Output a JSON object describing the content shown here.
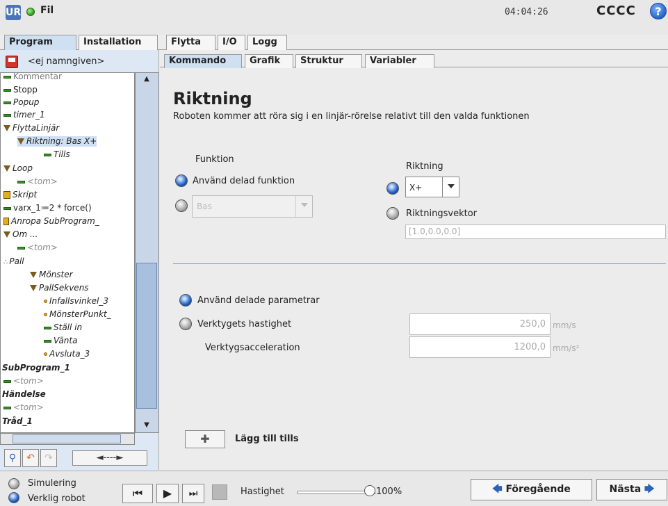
{
  "header": {
    "logo": "UR",
    "menu_label": "Fil",
    "clock": "04:04:26",
    "robot_name": "CCCC",
    "help_glyph": "?"
  },
  "main_tabs": [
    {
      "label": "Program",
      "active": true
    },
    {
      "label": "Installation",
      "active": false
    },
    {
      "label": "Flytta",
      "active": false
    },
    {
      "label": "I/O",
      "active": false
    },
    {
      "label": "Logg",
      "active": false
    }
  ],
  "program": {
    "name": "<ej namngiven>",
    "tree": [
      {
        "label": "Kommentar",
        "icon": "line-icon",
        "italic": false,
        "bold": false,
        "dim": true
      },
      {
        "label": "Stopp",
        "icon": "line-icon",
        "italic": false,
        "bold": false
      },
      {
        "label": "Popup",
        "icon": "line-icon",
        "italic": true,
        "bold": false
      },
      {
        "label": "timer_1",
        "icon": "line-icon",
        "italic": true,
        "bold": false
      },
      {
        "label": "FlyttaLinjär",
        "icon": "triangle-icon",
        "italic": true,
        "bold": false
      },
      {
        "label": "Riktning: Bas X+",
        "icon": "triangle-icon",
        "italic": true,
        "bold": false,
        "selected": true
      },
      {
        "label": "Tills",
        "icon": "line-icon",
        "italic": true,
        "bold": false
      },
      {
        "label": "Loop",
        "icon": "triangle-icon",
        "italic": true,
        "bold": false
      },
      {
        "label": "<tom>",
        "icon": "line-icon",
        "italic": true,
        "bold": false,
        "dim": true
      },
      {
        "label": "Skript",
        "icon": "script-icon",
        "italic": true,
        "bold": false
      },
      {
        "label": "varx_1≔2 * force()",
        "icon": "line-icon",
        "italic": false,
        "bold": false
      },
      {
        "label": "Anropa SubProgram_",
        "icon": "call-icon",
        "italic": true,
        "bold": false
      },
      {
        "label": "Om ...",
        "icon": "triangle-icon",
        "italic": true,
        "bold": false
      },
      {
        "label": "<tom>",
        "icon": "line-icon",
        "italic": true,
        "bold": false,
        "dim": true
      },
      {
        "label": "Pall",
        "icon": "pallet-icon",
        "italic": true,
        "bold": false
      },
      {
        "label": "Mönster",
        "icon": "triangle-icon",
        "italic": true,
        "bold": false
      },
      {
        "label": "PallSekvens",
        "icon": "triangle-icon",
        "italic": true,
        "bold": false
      },
      {
        "label": "Infallsvinkel_3",
        "icon": "waypoint-icon",
        "italic": true,
        "bold": false
      },
      {
        "label": "MönsterPunkt_",
        "icon": "waypoint-icon",
        "italic": true,
        "bold": false
      },
      {
        "label": "Ställ in",
        "icon": "line-icon",
        "italic": true,
        "bold": false
      },
      {
        "label": "Vänta",
        "icon": "line-icon",
        "italic": true,
        "bold": false
      },
      {
        "label": "Avsluta_3",
        "icon": "waypoint-icon",
        "italic": true,
        "bold": false
      },
      {
        "label": "SubProgram_1",
        "icon": "",
        "italic": true,
        "bold": true
      },
      {
        "label": "<tom>",
        "icon": "line-icon",
        "italic": true,
        "bold": false,
        "dim": true
      },
      {
        "label": "Händelse",
        "icon": "",
        "italic": true,
        "bold": true
      },
      {
        "label": "<tom>",
        "icon": "line-icon",
        "italic": true,
        "bold": false,
        "dim": true
      },
      {
        "label": "Tråd_1",
        "icon": "",
        "italic": true,
        "bold": true
      }
    ],
    "move_button": "◄----►"
  },
  "sub_tabs": [
    {
      "label": "Kommando",
      "active": true
    },
    {
      "label": "Grafik",
      "active": false
    },
    {
      "label": "Struktur",
      "active": false
    },
    {
      "label": "Variabler",
      "active": false
    }
  ],
  "command": {
    "title": "Riktning",
    "description": "Roboten kommer att röra sig i en linjär-rörelse relativt till den valda funktionen",
    "feature_label": "Funktion",
    "use_shared_feature": "Använd delad funktion",
    "feature_select": "Bas",
    "direction_label": "Riktning",
    "direction_select": "X+",
    "direction_vector_label": "Riktningsvektor",
    "direction_vector_value": "[1.0,0.0,0.0]",
    "use_shared_params": "Använd delade parametrar",
    "tool_speed_label": "Verktygets hastighet",
    "tool_speed_value": "250,0",
    "tool_speed_unit": "mm/s",
    "tool_accel_label": "Verktygsacceleration",
    "tool_accel_value": "1200,0",
    "tool_accel_unit": "mm/s²",
    "add_until_label": "Lägg till tills",
    "add_until_glyph": "✚"
  },
  "footer": {
    "simulation_label": "Simulering",
    "real_robot_label": "Verklig robot",
    "speed_label": "Hastighet",
    "speed_value": "100%",
    "speed_fraction": 1.0,
    "prev_label": "Föregående",
    "next_label": "Nästa"
  },
  "colors": {
    "accent": "#1f5fc4",
    "tree_bg": "#dde8f4",
    "active_tab": "#cfe0f2"
  }
}
